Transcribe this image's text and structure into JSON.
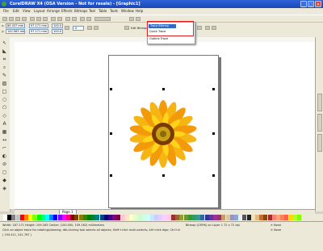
{
  "window": {
    "title": "CorelDRAW X4 (OSA Version - Not for resale) - [Graphic1]"
  },
  "menu": [
    "File",
    "Edit",
    "View",
    "Layout",
    "Arrange",
    "Effects",
    "Bitmaps",
    "Text",
    "Table",
    "Tools",
    "Window",
    "Help"
  ],
  "propbar": {
    "x": "89.437 mm",
    "y": "142.563 mm",
    "w": "97.171 mm",
    "h": "97.171 mm",
    "scale_x": "100.0",
    "scale_y": "100.0",
    "angle": ".0",
    "edit_bitmap": "Edit Bitmap..."
  },
  "popup": {
    "items": [
      "Trace Bitmap",
      "Quick Trace",
      "Outline Trace"
    ]
  },
  "page_tab": "Page 1",
  "status": {
    "line1": "Width: 187.171  Height: 109.163  Center: (100.000, 109.162) millimeters",
    "line2": "Click an object twice for rotating/skewing; dbl-clicking tool selects all objects; Shift+click multi-selects; Alt+click digs; Ctrl+click selects in a group",
    "line3": "Bitmap (CMYK) on Layer 1 72 x 72 dpi",
    "fill": "None",
    "outline": "None",
    "coords": "( 194.411, 241.767 )"
  },
  "colors": {
    "swatches": [
      "#ffffff",
      "#000000",
      "#808080",
      "#c0c0c0",
      "#ff0000",
      "#ff8000",
      "#ffff00",
      "#80ff00",
      "#00ff00",
      "#00ff80",
      "#00ffff",
      "#0080ff",
      "#0000ff",
      "#8000ff",
      "#ff00ff",
      "#ff0080",
      "#800000",
      "#804000",
      "#808000",
      "#408000",
      "#008000",
      "#008040",
      "#008080",
      "#004080",
      "#000080",
      "#400080",
      "#800080",
      "#800040",
      "#ffcccc",
      "#ffe5cc",
      "#ffffcc",
      "#e5ffcc",
      "#ccffcc",
      "#ccffe5",
      "#ccffff",
      "#cce5ff",
      "#ccccff",
      "#e5ccff",
      "#ffccff",
      "#ffcce5",
      "#993333",
      "#996633",
      "#999933",
      "#669933",
      "#339933",
      "#339966",
      "#339999",
      "#336699",
      "#333399",
      "#663399",
      "#993399",
      "#993366",
      "#cc9966",
      "#ccccaa",
      "#aa88cc",
      "#88aacc",
      "#eeeeee",
      "#555555",
      "#222222",
      "#f5deb3",
      "#deb887",
      "#d2691e",
      "#8b4513",
      "#a52a2a",
      "#fa8072",
      "#ffa07a",
      "#ff7f50",
      "#ff6347",
      "#ffd700",
      "#adff2f",
      "#7fff00"
    ]
  }
}
